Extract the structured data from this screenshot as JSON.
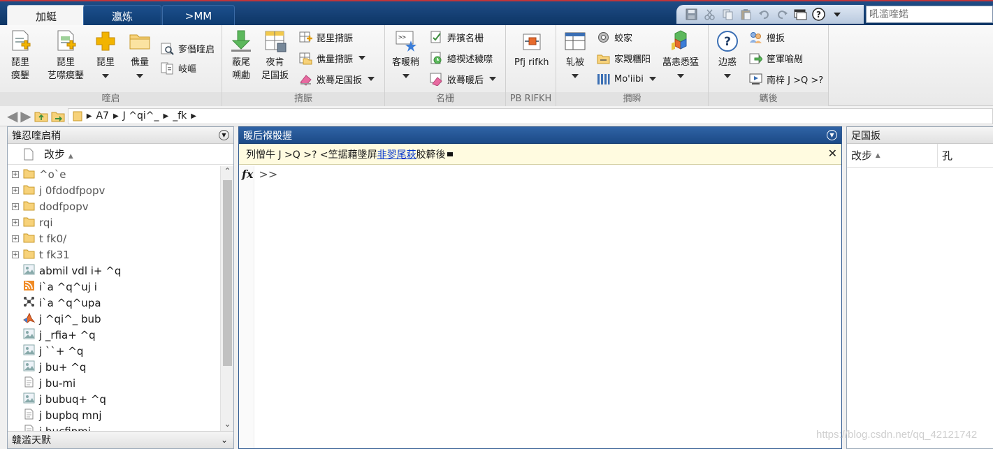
{
  "top_tabs": [
    {
      "label": "加蜓",
      "active": true
    },
    {
      "label": "瀛炼",
      "active": false
    },
    {
      "label": ">MM",
      "active": false
    }
  ],
  "quick_access_icons": [
    "save-icon",
    "cut-icon",
    "copy-icon",
    "paste-icon",
    "undo-icon",
    "redo-icon",
    "switch-windows-icon",
    "help-icon",
    "dropdown-icon"
  ],
  "search": {
    "placeholder": "吼滥喹婼"
  },
  "ribbon": {
    "sections": [
      {
        "label": "喹启",
        "buttons": [
          {
            "label": "琵里\n瘼鑋",
            "icon": "new-script-icon"
          },
          {
            "label": "琵里\n艺噤瘼鑋",
            "icon": "new-live-script-icon"
          },
          {
            "label": "琵里",
            "icon": "new-icon",
            "dropdown": true
          },
          {
            "label": "僬量",
            "icon": "open-icon",
            "dropdown": true
          }
        ],
        "small": [
          {
            "label": "奓僭喹启",
            "icon": "find-files-icon"
          },
          {
            "label": "岐嶇",
            "icon": "compare-icon"
          }
        ]
      },
      {
        "label": "揹脤",
        "buttons": [
          {
            "label": "蔽尾\n嗍勴",
            "icon": "import-data-icon"
          },
          {
            "label": "夜肯\n足国扳",
            "icon": "save-workspace-icon"
          }
        ],
        "small": [
          {
            "label": "琵里揹脤",
            "icon": "new-variable-icon"
          },
          {
            "label": "僬量揹脤",
            "icon": "open-variable-icon",
            "dropdown": true
          },
          {
            "label": "敚蓦足国扳",
            "icon": "clear-workspace-icon",
            "dropdown": true
          }
        ]
      },
      {
        "label": "名栅",
        "buttons": [
          {
            "label": "客暖稍",
            "icon": "favorites-icon",
            "dropdown": true
          }
        ],
        "small": [
          {
            "label": "弄獱名栅",
            "icon": "analyze-code-icon"
          },
          {
            "label": "繶禊述穢噤",
            "icon": "run-time-icon"
          },
          {
            "label": "敚蓦暖后",
            "icon": "clear-commands-icon",
            "dropdown": true
          }
        ]
      },
      {
        "label": "PB RIFKH",
        "buttons": [
          {
            "label": "Pfj rifkh",
            "icon": "simulink-icon"
          }
        ],
        "small": []
      },
      {
        "label": "撊瞬",
        "buttons": [
          {
            "label": "轧被",
            "icon": "layout-icon",
            "dropdown": true
          }
        ],
        "small": [
          {
            "label": "蛟家",
            "icon": "preferences-icon"
          },
          {
            "label": "家覭糰阳",
            "icon": "set-path-icon"
          },
          {
            "label": "Mo'iibi",
            "icon": "parallel-icon",
            "dropdown": true
          }
        ],
        "extra": {
          "label": "藠恚悉猛",
          "icon": "add-ons-icon",
          "dropdown": true
        }
      },
      {
        "label": "觽後",
        "buttons": [
          {
            "label": "边惑",
            "icon": "help-icon",
            "dropdown": true
          }
        ],
        "small": [
          {
            "label": "橧扳",
            "icon": "community-icon"
          },
          {
            "label": "筐軍喻剮",
            "icon": "request-support-icon"
          },
          {
            "label": "南梓 J >Q >?",
            "icon": "learn-matlab-icon"
          }
        ]
      }
    ]
  },
  "address": {
    "crumbs": [
      "A7",
      "J ^qi^_",
      "_fk"
    ]
  },
  "left_panel": {
    "title": "锥忍喹启稍",
    "column_header": "改步",
    "files": [
      {
        "name": "^o`e",
        "type": "folder",
        "expandable": true
      },
      {
        "name": "j 0fdodfpopv",
        "type": "folder",
        "expandable": true
      },
      {
        "name": "dodfpopv",
        "type": "folder",
        "expandable": true
      },
      {
        "name": "rqi",
        "type": "folder",
        "expandable": true
      },
      {
        "name": "t fk0/",
        "type": "folder",
        "expandable": true
      },
      {
        "name": "t fk31",
        "type": "folder",
        "expandable": true
      },
      {
        "name": "abmil vdl i+ ^q",
        "type": "image",
        "expandable": false
      },
      {
        "name": "i`a ^q^uj i",
        "type": "rss",
        "expandable": false
      },
      {
        "name": "i`a ^q^upa",
        "type": "network",
        "expandable": false
      },
      {
        "name": "j ^qi^_ bub",
        "type": "matlab",
        "expandable": false
      },
      {
        "name": "j _rfia+ ^q",
        "type": "image",
        "expandable": false
      },
      {
        "name": "j ``+ ^q",
        "type": "image",
        "expandable": false
      },
      {
        "name": "j bu+ ^q",
        "type": "image",
        "expandable": false
      },
      {
        "name": "j bu-mi",
        "type": "doc",
        "expandable": false
      },
      {
        "name": "j bubuq+ ^q",
        "type": "image",
        "expandable": false
      },
      {
        "name": "j bupbq mnj",
        "type": "doc",
        "expandable": false
      },
      {
        "name": "j bucfipmi",
        "type": "doc",
        "expandable": false
      }
    ],
    "footer": "竷滥天默"
  },
  "center_panel": {
    "title": "暖后褓骰握",
    "notice_text": "列憎牛 J >Q >? <笁据藉墬屏",
    "notice_link": "非翏尾萩",
    "notice_tail": "胶簳後",
    "fx_label": "fx",
    "prompt": ">>"
  },
  "right_panel": {
    "title": "足国扳",
    "col1": "改步",
    "col2": "孔"
  },
  "watermark": "https://blog.csdn.net/qq_42121742"
}
